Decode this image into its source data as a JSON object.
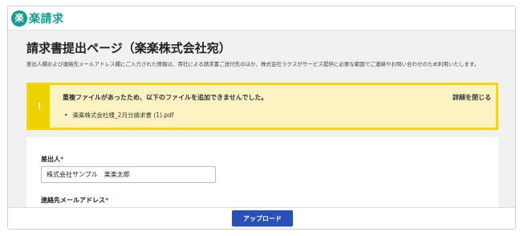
{
  "brand": {
    "mark": "楽",
    "name": "楽請求",
    "color": "#0e9f8e"
  },
  "page": {
    "title": "請求書提出ページ（楽楽株式会社宛）",
    "notice": "差出人欄および連絡先メールアドレス欄にご入力された情報は、貴社による請求書ご送付先のほか、株式会社ラクスがサービス提供に必要な範囲でご連絡やお問い合わせのため利用いたします。"
  },
  "alert": {
    "icon": "!",
    "title": "重複ファイルがあったため、以下のファイルを追加できませんでした。",
    "close_label": "詳細を閉じる",
    "files": [
      "楽楽株式会社様_2月分請求書 (1).pdf"
    ],
    "border_color": "#f5d800",
    "background_color": "#fdf3c2"
  },
  "form": {
    "sender": {
      "label": "差出人",
      "required_mark": "*",
      "value": "株式会社サンプル　楽楽太郎"
    },
    "email": {
      "label": "連絡先メールアドレス",
      "required_mark": "*",
      "value": ""
    }
  },
  "footer": {
    "upload_label": "アップロード",
    "button_color": "#2a4fb7"
  }
}
